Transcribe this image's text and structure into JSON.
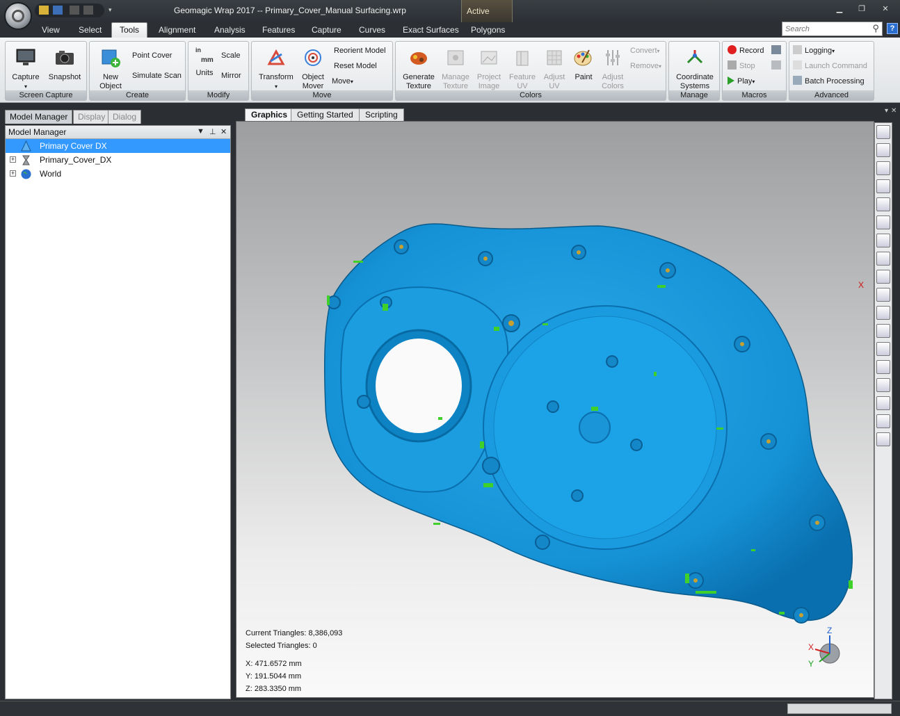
{
  "app": {
    "title": "Geomagic Wrap 2017 -- Primary_Cover_Manual Surfacing.wrp",
    "context_tab": "Active"
  },
  "ribbon_tabs": [
    "View",
    "Select",
    "Tools",
    "Alignment",
    "Analysis",
    "Features",
    "Capture",
    "Curves",
    "Exact Surfaces",
    "Polygons"
  ],
  "active_tab": "Tools",
  "search": {
    "placeholder": "Search"
  },
  "help_label": "?",
  "groups": {
    "screen_capture": {
      "label": "Screen Capture",
      "capture": "Capture",
      "snapshot": "Snapshot"
    },
    "create": {
      "label": "Create",
      "new_object": "New Object",
      "point_cover": "Point Cover",
      "simulate_scan": "Simulate Scan"
    },
    "modify": {
      "label": "Modify",
      "units": "Units",
      "scale": "Scale",
      "mirror": "Mirror",
      "units_top": "in",
      "units_bottom": "mm"
    },
    "move": {
      "label": "Move",
      "transform": "Transform",
      "object_mover": "Object Mover",
      "reorient_model": "Reorient Model",
      "reset_model": "Reset Model",
      "move": "Move"
    },
    "colors": {
      "label": "Colors",
      "generate_texture": "Generate Texture",
      "manage_texture": "Manage Texture",
      "project_image": "Project Image",
      "feature_uv": "Feature UV",
      "adjust_uv": "Adjust UV",
      "paint": "Paint",
      "adjust_colors": "Adjust Colors",
      "convert": "Convert",
      "remove": "Remove"
    },
    "manage": {
      "label": "Manage",
      "coordinate_systems": "Coordinate Systems"
    },
    "macros": {
      "label": "Macros",
      "record": "Record",
      "stop": "Stop",
      "play": "Play"
    },
    "advanced": {
      "label": "Advanced",
      "logging": "Logging",
      "launch_command": "Launch Command",
      "batch_processing": "Batch Processing"
    }
  },
  "panel_tabs": [
    "Model Manager",
    "Display",
    "Dialog"
  ],
  "model_manager": {
    "title": "Model Manager",
    "nodes": [
      {
        "label": "Primary Cover DX",
        "selected": true
      },
      {
        "label": "Primary_Cover_DX",
        "selected": false
      },
      {
        "label": "World",
        "selected": false
      }
    ]
  },
  "graphics_tabs": [
    "Graphics",
    "Getting Started",
    "Scripting"
  ],
  "stats": {
    "current_triangles": "Current Triangles: 8,386,093",
    "selected_triangles": "Selected Triangles: 0",
    "x": "X:  471.6572 mm",
    "y": "Y:  191.5044 mm",
    "z": "Z:  283.3350 mm"
  },
  "axis_labels": {
    "x": "X",
    "y": "Y",
    "z": "Z"
  },
  "colors": {
    "mesh": "#1e9fe0",
    "accent": "#3399ff"
  }
}
